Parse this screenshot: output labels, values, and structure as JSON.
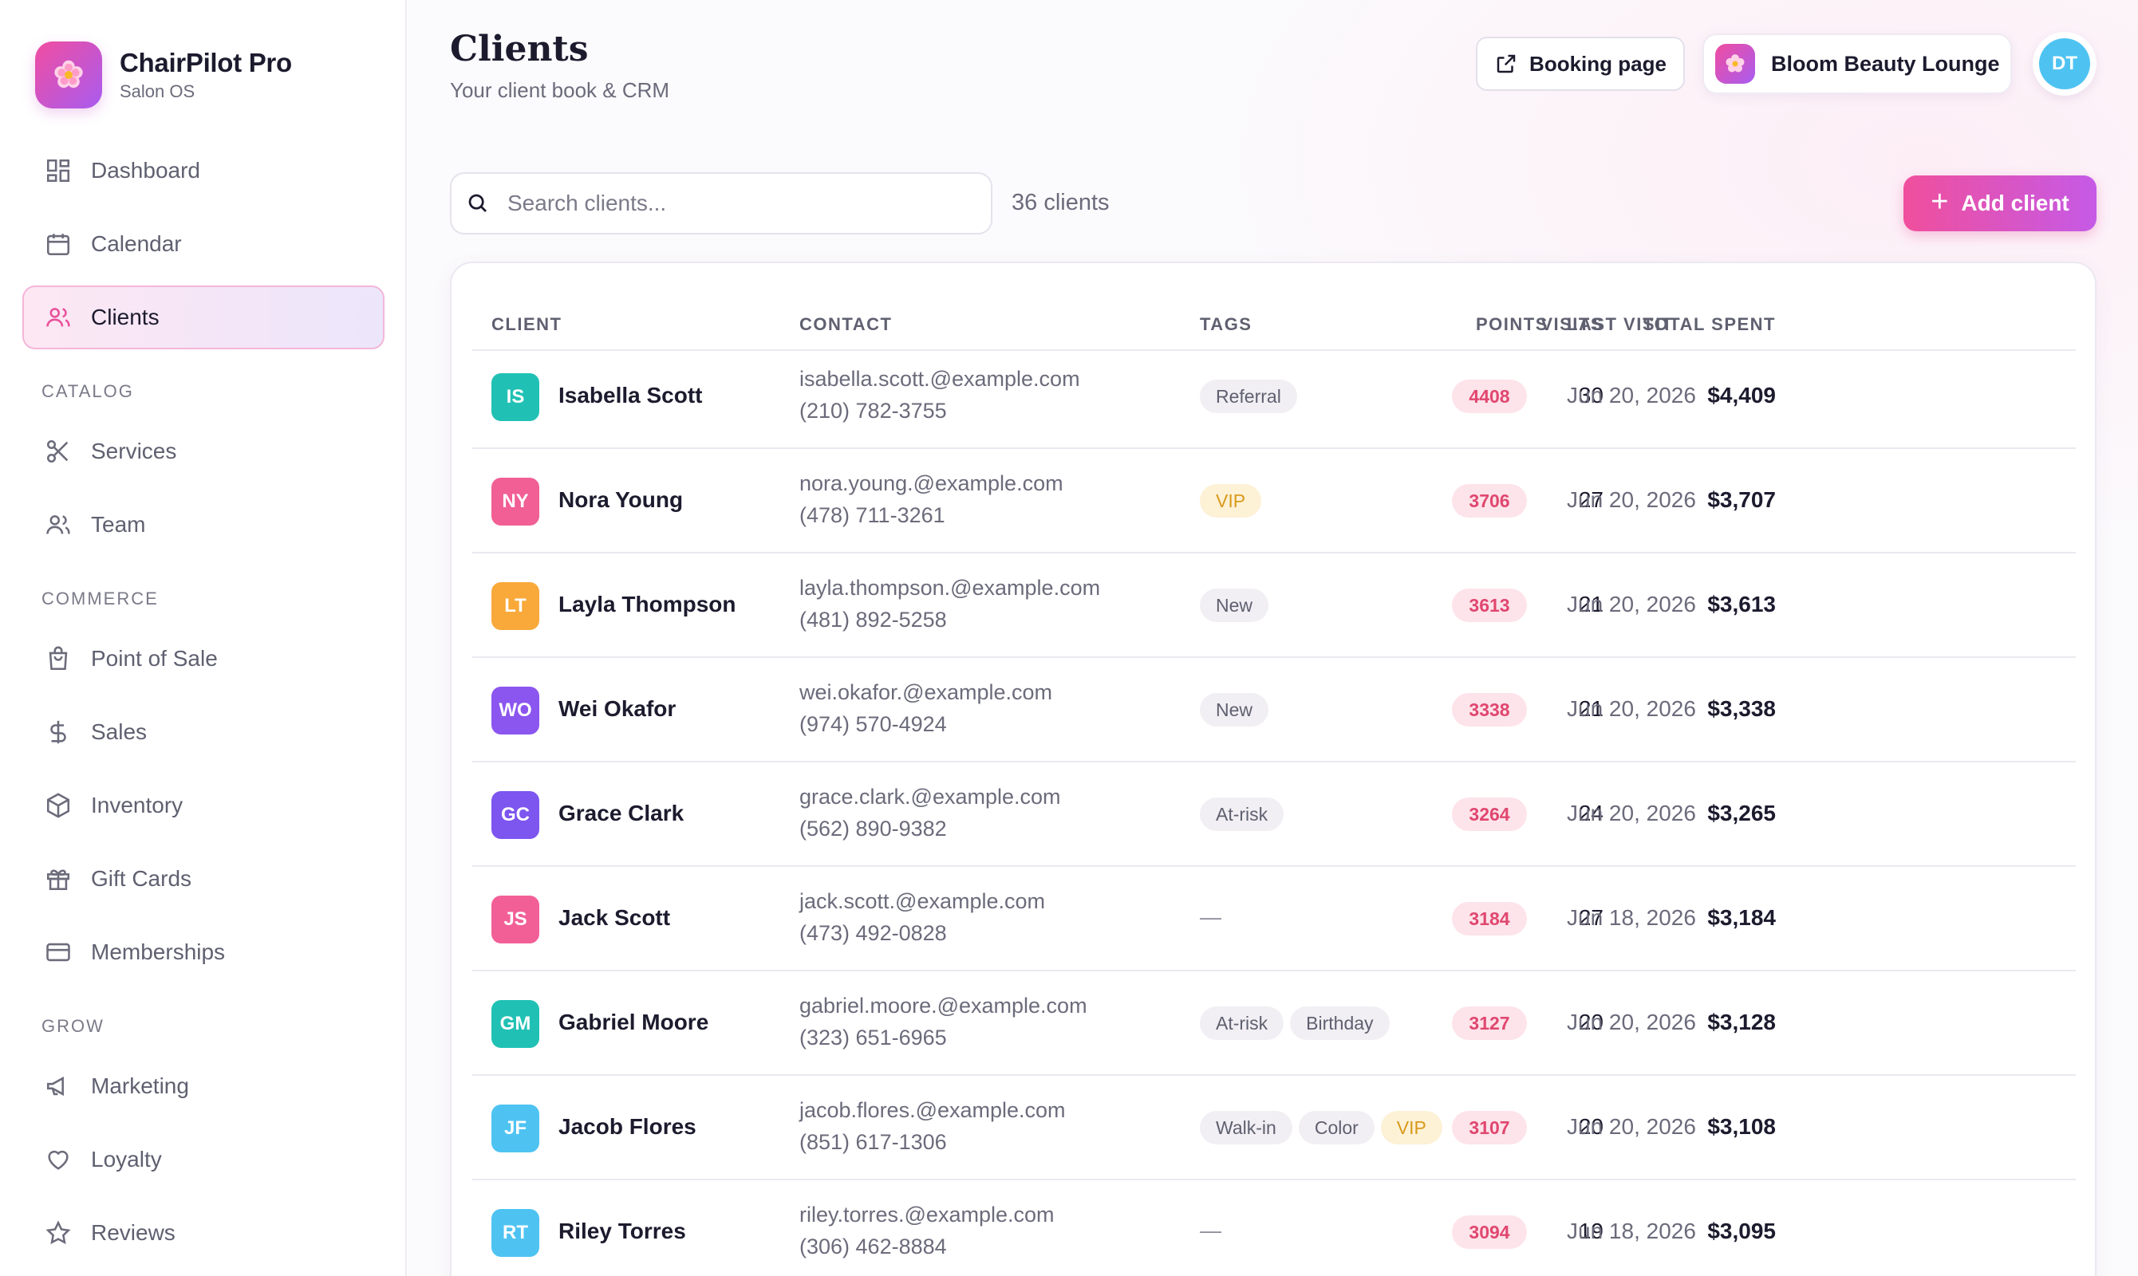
{
  "brand": {
    "name": "ChairPilot Pro",
    "subtitle": "Salon OS",
    "logo_icon": "flower-icon"
  },
  "sidebar": {
    "items_top": [
      {
        "label": "Dashboard",
        "icon": "dashboard-icon"
      },
      {
        "label": "Calendar",
        "icon": "calendar-icon"
      },
      {
        "label": "Clients",
        "icon": "users-icon",
        "active": true
      }
    ],
    "sections": [
      {
        "title": "CATALOG",
        "items": [
          {
            "label": "Services",
            "icon": "scissors-icon"
          },
          {
            "label": "Team",
            "icon": "team-icon"
          }
        ]
      },
      {
        "title": "COMMERCE",
        "items": [
          {
            "label": "Point of Sale",
            "icon": "shopping-bag-icon"
          },
          {
            "label": "Sales",
            "icon": "dollar-icon"
          },
          {
            "label": "Inventory",
            "icon": "box-icon"
          },
          {
            "label": "Gift Cards",
            "icon": "gift-icon"
          },
          {
            "label": "Memberships",
            "icon": "card-icon"
          }
        ]
      },
      {
        "title": "GROW",
        "items": [
          {
            "label": "Marketing",
            "icon": "megaphone-icon"
          },
          {
            "label": "Loyalty",
            "icon": "heart-icon"
          },
          {
            "label": "Reviews",
            "icon": "star-icon"
          }
        ]
      }
    ]
  },
  "header": {
    "title": "Clients",
    "subtitle": "Your client book & CRM",
    "booking_label": "Booking page",
    "salon_name": "Bloom Beauty Lounge",
    "user_initials": "DT"
  },
  "toolbar": {
    "search_placeholder": "Search clients...",
    "count_label": "36 clients",
    "add_label": "Add client"
  },
  "table": {
    "columns": {
      "client": "CLIENT",
      "contact": "CONTACT",
      "tags": "TAGS",
      "visits": "VISITS",
      "total_spent": "TOTAL SPENT",
      "points": "POINTS",
      "last_visit": "LAST VISIT"
    },
    "empty_tag": "—",
    "rows": [
      {
        "initials": "IS",
        "color": "#20c1b4",
        "name": "Isabella Scott",
        "email": "isabella.scott.@example.com",
        "phone": "(210) 782-3755",
        "tags": [
          "Referral"
        ],
        "visits": "30",
        "spent": "$4,409",
        "points": "4408",
        "last": "Jun 20, 2026"
      },
      {
        "initials": "NY",
        "color": "#f15f94",
        "name": "Nora Young",
        "email": "nora.young.@example.com",
        "phone": "(478) 711-3261",
        "tags": [
          "VIP"
        ],
        "visits": "27",
        "spent": "$3,707",
        "points": "3706",
        "last": "Jun 20, 2026"
      },
      {
        "initials": "LT",
        "color": "#f8a93a",
        "name": "Layla Thompson",
        "email": "layla.thompson.@example.com",
        "phone": "(481) 892-5258",
        "tags": [
          "New"
        ],
        "visits": "21",
        "spent": "$3,613",
        "points": "3613",
        "last": "Jun 20, 2026"
      },
      {
        "initials": "WO",
        "color": "#8b55ef",
        "name": "Wei Okafor",
        "email": "wei.okafor.@example.com",
        "phone": "(974) 570-4924",
        "tags": [
          "New"
        ],
        "visits": "21",
        "spent": "$3,338",
        "points": "3338",
        "last": "Jun 20, 2026"
      },
      {
        "initials": "GC",
        "color": "#7d55ef",
        "name": "Grace Clark",
        "email": "grace.clark.@example.com",
        "phone": "(562) 890-9382",
        "tags": [
          "At-risk"
        ],
        "visits": "24",
        "spent": "$3,265",
        "points": "3264",
        "last": "Jun 20, 2026"
      },
      {
        "initials": "JS",
        "color": "#f25f97",
        "name": "Jack Scott",
        "email": "jack.scott.@example.com",
        "phone": "(473) 492-0828",
        "tags": [],
        "visits": "27",
        "spent": "$3,184",
        "points": "3184",
        "last": "Jun 18, 2026"
      },
      {
        "initials": "GM",
        "color": "#20c1b4",
        "name": "Gabriel Moore",
        "email": "gabriel.moore.@example.com",
        "phone": "(323) 651-6965",
        "tags": [
          "At-risk",
          "Birthday"
        ],
        "visits": "20",
        "spent": "$3,128",
        "points": "3127",
        "last": "Jun 20, 2026"
      },
      {
        "initials": "JF",
        "color": "#4ec3f2",
        "name": "Jacob Flores",
        "email": "jacob.flores.@example.com",
        "phone": "(851) 617-1306",
        "tags": [
          "Walk-in",
          "Color",
          "VIP"
        ],
        "visits": "20",
        "spent": "$3,108",
        "points": "3107",
        "last": "Jun 20, 2026"
      },
      {
        "initials": "RT",
        "color": "#4ec3f2",
        "name": "Riley Torres",
        "email": "riley.torres.@example.com",
        "phone": "(306) 462-8884",
        "tags": [],
        "visits": "19",
        "spent": "$3,095",
        "points": "3094",
        "last": "Jun 18, 2026"
      }
    ]
  }
}
